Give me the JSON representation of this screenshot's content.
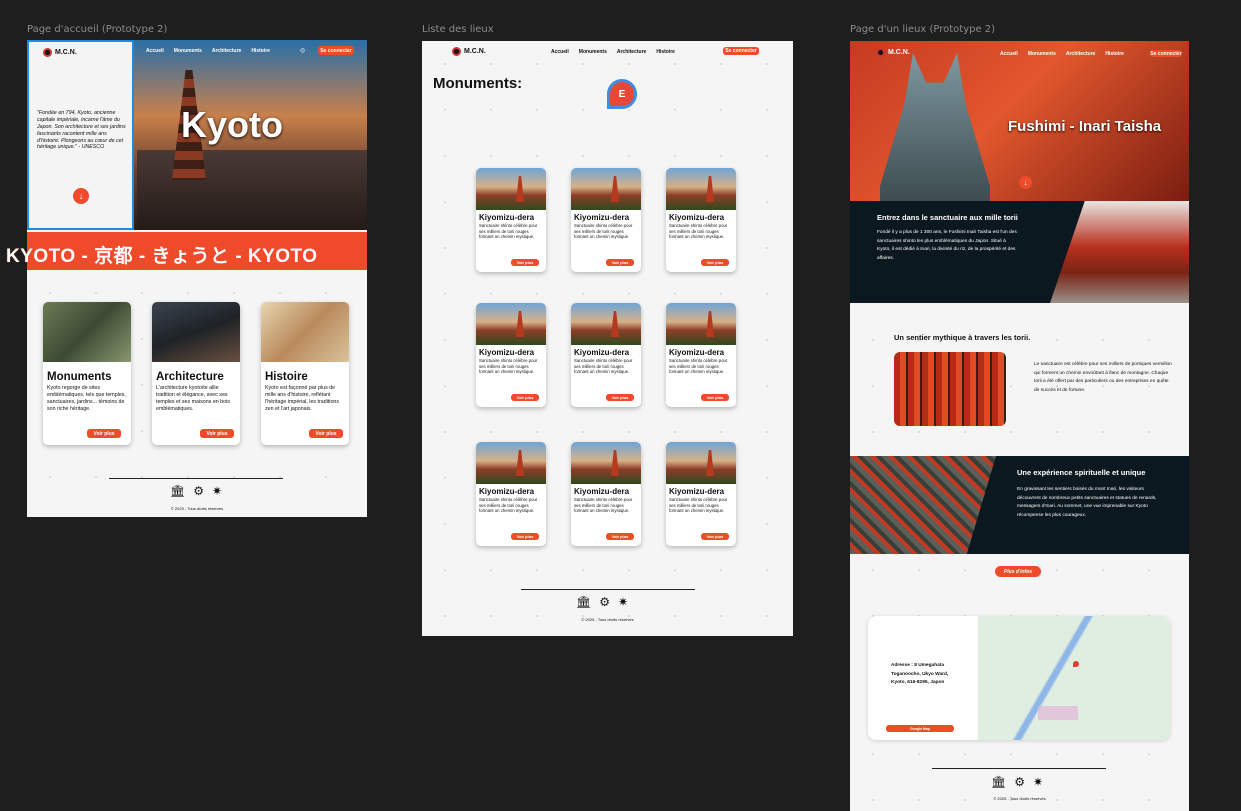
{
  "frame_labels": {
    "home": "Page d'accueil (Prototype 2)",
    "list": "Liste des lieux",
    "detail": "Page d'un lieux (Prototype 2)"
  },
  "brand": {
    "logo_text": "M.C.N."
  },
  "nav": {
    "home": "Accueil",
    "monuments": "Monuments",
    "architecture": "Architecture",
    "history": "Histoire",
    "login": "Se connecter"
  },
  "home": {
    "quote": "\"Fondée en 794, Kyoto, ancienne capitale impériale, incarne l'âme du Japon. Son architecture et ses jardins fascinants racontent mille ans d'histoire. Plongeons au cœur de cet héritage unique.\" - UNESCO",
    "hero_title": "Kyoto",
    "banner": "KYOTO - 京都 - きょうと - KYOTO",
    "categories": [
      {
        "title": "Monuments",
        "desc": "Kyoto regorge de sites emblématiques, tels que temples, sanctuaires, jardins... témoins de son riche héritage.",
        "button": "Voir plus"
      },
      {
        "title": "Architecture",
        "desc": "L'architecture kyotoïte allie tradition et élégance, avec ses temples et ses maisons en bois emblématiques.",
        "button": "Voir plus"
      },
      {
        "title": "Histoire",
        "desc": "Kyoto est façonné par plus de mille ans d'histoire, reflétant l'héritage impérial, les traditions zen et l'art japonais.",
        "button": "Voir plus"
      }
    ]
  },
  "list": {
    "title": "Monuments:",
    "cursor_letter": "E",
    "card": {
      "name": "Kiyomizu-dera",
      "desc": "Sanctuaire shinto célèbre pour ses milliers de torii rouges formant un chemin mystique.",
      "button": "Voir plus"
    }
  },
  "detail": {
    "hero_title": "Fushimi - Inari Taisha",
    "s1_title": "Entrez dans le sanctuaire aux mille torii",
    "s1_body": "Fondé il y a plus de 1 300 ans, le Fushimi Inari Taisha est l'un des sanctuaires shinto les plus emblématiques du Japon. Situé à Kyoto, il est dédié à Inari, la divinité du riz, de la prospérité et des affaires.",
    "s2_title": "Un sentier mythique à travers les torii.",
    "s2_body": "Le sanctuaire est célèbre pour ses milliers de portiques vermillon qui forment un chemin envoûtant à flanc de montagne. Chaque torii a été offert par des particuliers ou des entreprises en quête de succès et de fortune.",
    "s3_title": "Une expérience spirituelle et unique",
    "s3_body": "En gravissant les sentiers boisés du mont Inari, les visiteurs découvrent de nombreux petits sanctuaires et statues de renards, messagers d'Inari. Au sommet, une vue imprenable sur Kyoto récompense les plus courageux.",
    "more_button": "Plus d'infos",
    "address": "Adresse : 8 Umegahata Toganoocho, Ukyo Ward, Kyoto, 616-8295, Japon",
    "maps_button": "Google Map"
  },
  "footer": {
    "copyright": "© 2025 - Tous droits réservés",
    "icons": [
      "temple-icon",
      "gear-icon",
      "sparkle-icon"
    ]
  },
  "colors": {
    "accent": "#ef4a2a",
    "dark": "#0c1820",
    "canvas": "#1e1e1e"
  }
}
